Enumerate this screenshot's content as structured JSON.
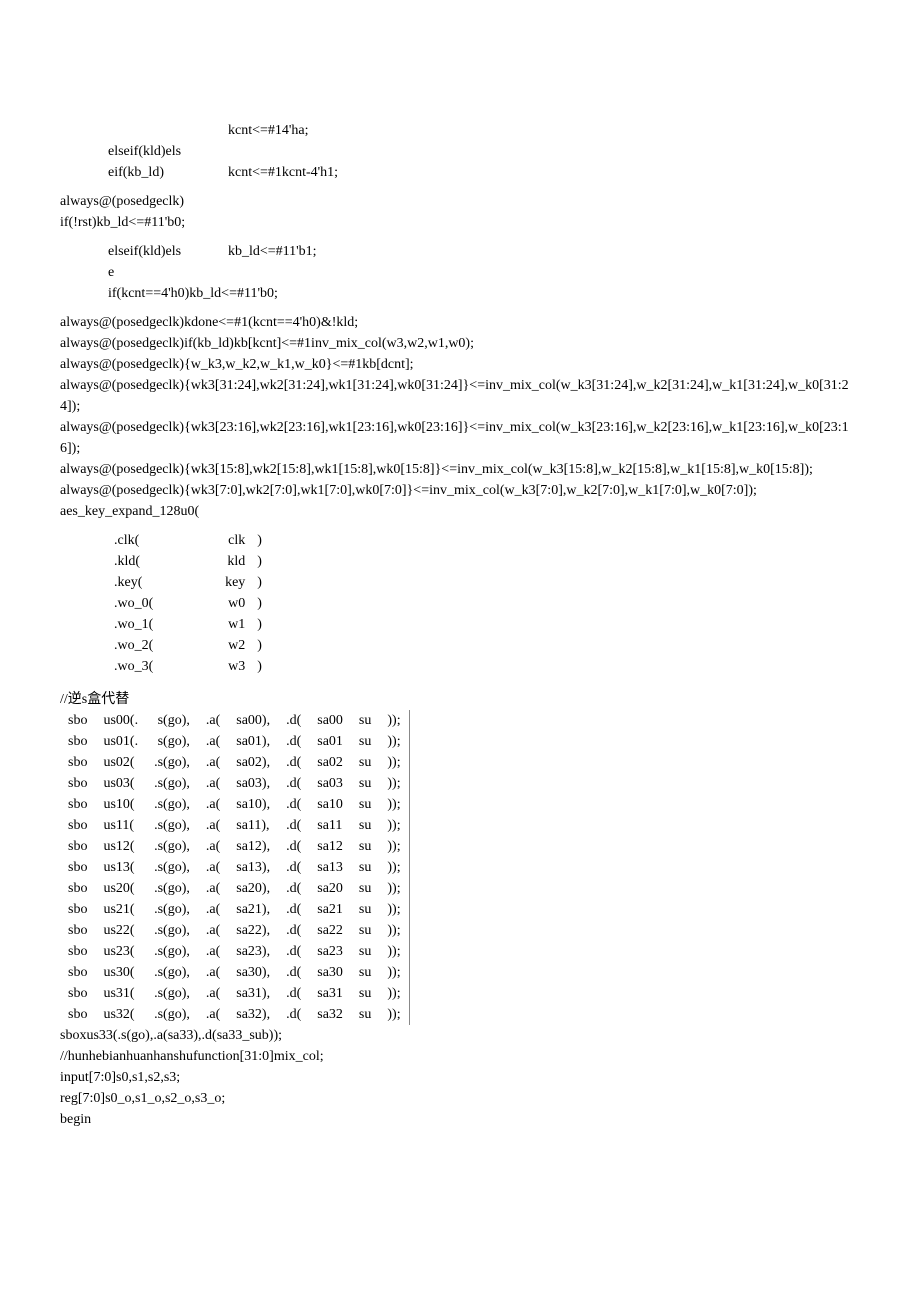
{
  "l1a": "kcnt<=#14'ha;",
  "l1b_left": "elseif(kld)els",
  "l1c_left": "eif(kb_ld)",
  "l1c_right": "kcnt<=#1kcnt-4'h1;",
  "l2": "always@(posedgeclk)",
  "l3": "if(!rst)kb_ld<=#11'b0;",
  "l4_left": "elseif(kld)els\ne",
  "l4_right": "kb_ld<=#11'b1;",
  "l5": "if(kcnt==4'h0)kb_ld<=#11'b0;",
  "b1": "always@(posedgeclk)kdone<=#1(kcnt==4'h0)&!kld;",
  "b2": "always@(posedgeclk)if(kb_ld)kb[kcnt]<=#1inv_mix_col(w3,w2,w1,w0);",
  "b3": "always@(posedgeclk){w_k3,w_k2,w_k1,w_k0}<=#1kb[dcnt];",
  "b4": "always@(posedgeclk){wk3[31:24],wk2[31:24],wk1[31:24],wk0[31:24]}<=inv_mix_col(w_k3[31:24],w_k2[31:24],w_k1[31:24],w_k0[31:24]);",
  "b5": "always@(posedgeclk){wk3[23:16],wk2[23:16],wk1[23:16],wk0[23:16]}<=inv_mix_col(w_k3[23:16],w_k2[23:16],w_k1[23:16],w_k0[23:16]);",
  "b6": "always@(posedgeclk){wk3[15:8],wk2[15:8],wk1[15:8],wk0[15:8]}<=inv_mix_col(w_k3[15:8],w_k2[15:8],w_k1[15:8],w_k0[15:8]);",
  "b7": "always@(posedgeclk){wk3[7:0],wk2[7:0],wk1[7:0],wk0[7:0]}<=inv_mix_col(w_k3[7:0],w_k2[7:0],w_k1[7:0],w_k0[7:0]);",
  "b8": "aes_key_expand_128u0(",
  "key_rows": [
    [
      ".clk(",
      "clk",
      ")"
    ],
    [
      ".kld(",
      "kld",
      ")"
    ],
    [
      ".key(",
      "key",
      ")"
    ],
    [
      ".wo_0(",
      "w0",
      ")"
    ],
    [
      ".wo_1(",
      "w1",
      ")"
    ],
    [
      ".wo_2(",
      "w2",
      ")"
    ],
    [
      ".wo_3(",
      "w3",
      ")"
    ]
  ],
  "comment": "//逆s盒代替",
  "sbox_rows": [
    [
      "sbo",
      "us00(.",
      "s(go),",
      ".a(",
      "sa00),",
      ".d(",
      "sa00_su",
      "));"
    ],
    [
      "sbo",
      "us01(.",
      "s(go),",
      ".a(",
      "sa01),",
      ".d(",
      "sa01_su",
      "));"
    ],
    [
      "sbo",
      "us02(",
      ".s(go),",
      ".a(",
      "sa02),",
      ".d(",
      "sa02_su",
      "));"
    ],
    [
      "sbo",
      "us03(",
      ".s(go),",
      ".a(",
      "sa03),",
      ".d(",
      "sa03_su",
      "));"
    ],
    [
      "sbo",
      "us10(",
      ".s(go),",
      ".a(",
      "sa10),",
      ".d(",
      "sa10_su",
      "));"
    ],
    [
      "sbo",
      "us11(",
      ".s(go),",
      ".a(",
      "sa11),",
      ".d(",
      "sa11_su",
      "));"
    ],
    [
      "sbo",
      "us12(",
      ".s(go),",
      ".a(",
      "sa12),",
      ".d(",
      "sa12_su",
      "));"
    ],
    [
      "sbo",
      "us13(",
      ".s(go),",
      ".a(",
      "sa13),",
      ".d(",
      "sa13_su",
      "));"
    ],
    [
      "sbo",
      "us20(",
      ".s(go),",
      ".a(",
      "sa20),",
      ".d(",
      "sa20_su",
      "));"
    ],
    [
      "sbo",
      "us21(",
      ".s(go),",
      ".a(",
      "sa21),",
      ".d(",
      "sa21_su",
      "));"
    ],
    [
      "sbo",
      "us22(",
      ".s(go),",
      ".a(",
      "sa22),",
      ".d(",
      "sa22_su",
      "));"
    ],
    [
      "sbo",
      "us23(",
      ".s(go),",
      ".a(",
      "sa23),",
      ".d(",
      "sa23_su",
      "));"
    ],
    [
      "sbo",
      "us30(",
      ".s(go),",
      ".a(",
      "sa30),",
      ".d(",
      "sa30_su",
      "));"
    ],
    [
      "sbo",
      "us31(",
      ".s(go),",
      ".a(",
      "sa31),",
      ".d(",
      "sa31_su",
      "));"
    ],
    [
      "sbo",
      "us32(",
      ".s(go),",
      ".a(",
      "sa32),",
      ".d(",
      "sa32_su",
      "));"
    ]
  ],
  "f1": "sboxus33(.s(go),.a(sa33),.d(sa33_sub));",
  "f2": "//hunhebianhuanhanshufunction[31:0]mix_col;",
  "f3": "input[7:0]s0,s1,s2,s3;",
  "f4": "reg[7:0]s0_o,s1_o,s2_o,s3_o;",
  "f5": "begin"
}
